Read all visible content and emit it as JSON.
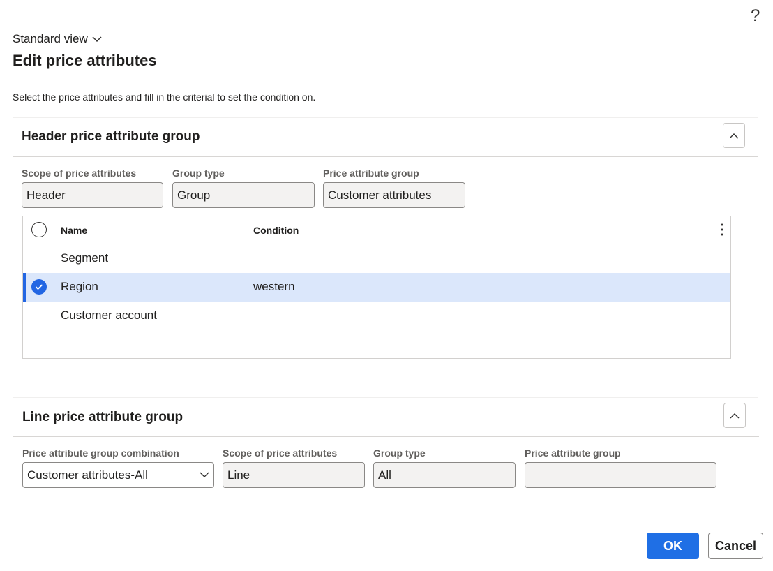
{
  "header": {
    "view_label": "Standard view",
    "title": "Edit price attributes",
    "instruction": "Select the price attributes and fill in the criterial to set the condition on.",
    "help_symbol": "?"
  },
  "header_group": {
    "title": "Header price attribute group",
    "fields": {
      "scope": {
        "label": "Scope of price attributes",
        "value": "Header"
      },
      "group_type": {
        "label": "Group type",
        "value": "Group"
      },
      "price_attribute_group": {
        "label": "Price attribute group",
        "value": "Customer attributes"
      }
    },
    "grid": {
      "columns": [
        "Name",
        "Condition"
      ],
      "rows": [
        {
          "name": "Segment",
          "condition": "",
          "selected": false
        },
        {
          "name": "Region",
          "condition": "western",
          "selected": true
        },
        {
          "name": "Customer account",
          "condition": "",
          "selected": false
        }
      ]
    }
  },
  "line_group": {
    "title": "Line price attribute group",
    "fields": {
      "combination": {
        "label": "Price attribute group combination",
        "value": "Customer attributes-All"
      },
      "scope": {
        "label": "Scope of price attributes",
        "value": "Line"
      },
      "group_type": {
        "label": "Group type",
        "value": "All"
      },
      "price_attribute_group": {
        "label": "Price attribute group",
        "value": ""
      }
    }
  },
  "buttons": {
    "ok": "OK",
    "cancel": "Cancel"
  },
  "colors": {
    "accent": "#1f6fe5",
    "selected_row": "#dbe7fb"
  }
}
